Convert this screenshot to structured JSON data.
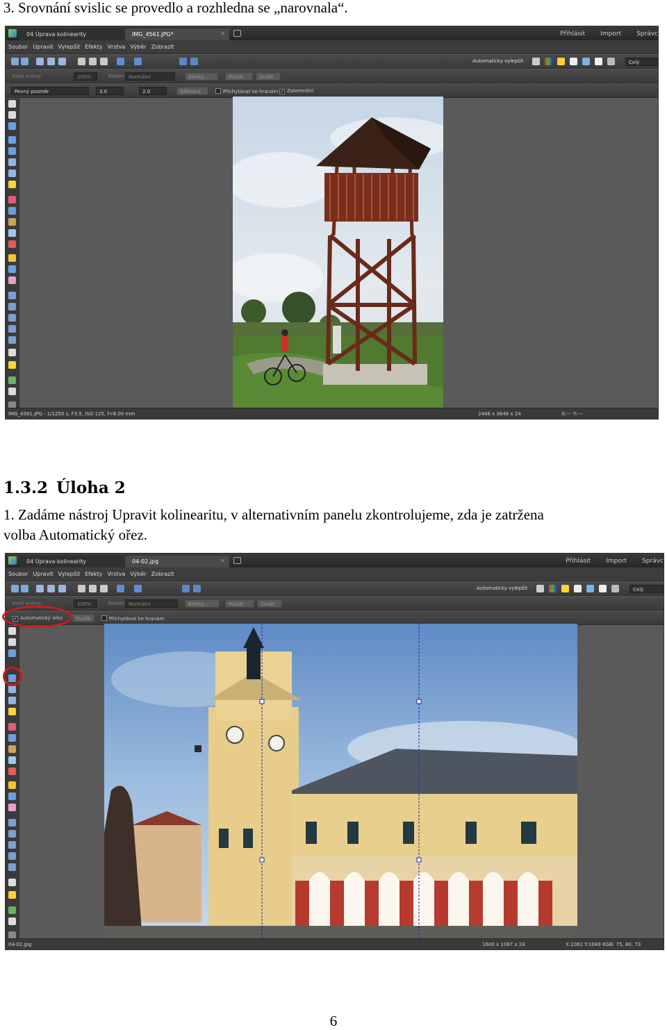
{
  "step3_text": "3. Srovnání svislic se provedlo a rozhledna se „narovnala“.",
  "section": {
    "number": "1.3.2",
    "title": "Úloha 2"
  },
  "step1": {
    "line1": "1. Zadáme nástroj Upravit kolinearitu, v alternativním panelu zkontrolujeme, zda je zatržena",
    "line2": "volba Automatický ořez."
  },
  "page_number": "6",
  "screenshot1": {
    "workspace_tab": "04 Úprava kolinearity",
    "file_tab": "IMG_4561.JPG*",
    "tab_close": "✕",
    "top_links": [
      "Přihlásit",
      "Import",
      "Správc"
    ],
    "menu": [
      "Soubor",
      "Upravit",
      "Vylepšit",
      "Efekty",
      "Vrstva",
      "Výběr",
      "Zobrazit"
    ],
    "auto_enhance": "Automaticky vylepšit",
    "zoom_select": "Celý",
    "layer_opacity_label": "Krytí vrstvy:",
    "layer_opacity_value": "100%",
    "mode_label": "Režim:",
    "mode_value": "Normální",
    "effects_button": "Efekty...",
    "apply_button": "Použít",
    "cancel_button": "Zrušit",
    "brush_select": "Pevný pozměr",
    "value_a": "3.0",
    "value_b": "2.0",
    "crop_button": "Oříznout",
    "snap_checkbox": "Přichytávat ke hranám",
    "enable_checkbox": "Zatemnění",
    "status_file": "IMG_4561.JPG - 1/1250 s, F3.5, ISO 125, f=6.00 mm",
    "status_size": "2446 x 3648 x 24",
    "status_coords": "X:--- Y:---"
  },
  "screenshot2": {
    "workspace_tab": "04 Úprava kolinearity",
    "file_tab": "04-02.jpg",
    "tab_close": "✕",
    "top_links": [
      "Přihlásit",
      "Import",
      "Správc"
    ],
    "menu": [
      "Soubor",
      "Upravit",
      "Vylepšit",
      "Efekty",
      "Vrstva",
      "Výběr",
      "Zobrazit"
    ],
    "auto_enhance": "Automaticky vylepšit",
    "zoom_select": "Celý",
    "layer_opacity_label": "Krytí vrstvy:",
    "layer_opacity_value": "100%",
    "mode_label": "Režim:",
    "mode_value": "Normální",
    "effects_button": "Efekty...",
    "apply_button": "Použít",
    "cancel_button": "Zrušit",
    "auto_crop_checkbox": "Automatický ořez",
    "auto_crop_checked": "✓",
    "apply_small_button": "Použít",
    "snap_checkbox": "Přichytávat ke hranám",
    "status_file": "04-02.jpg",
    "status_size": "1600 x 1067 x 24",
    "status_coords": "X:1061 Y:1049  RGB: 75, 80, 73"
  }
}
